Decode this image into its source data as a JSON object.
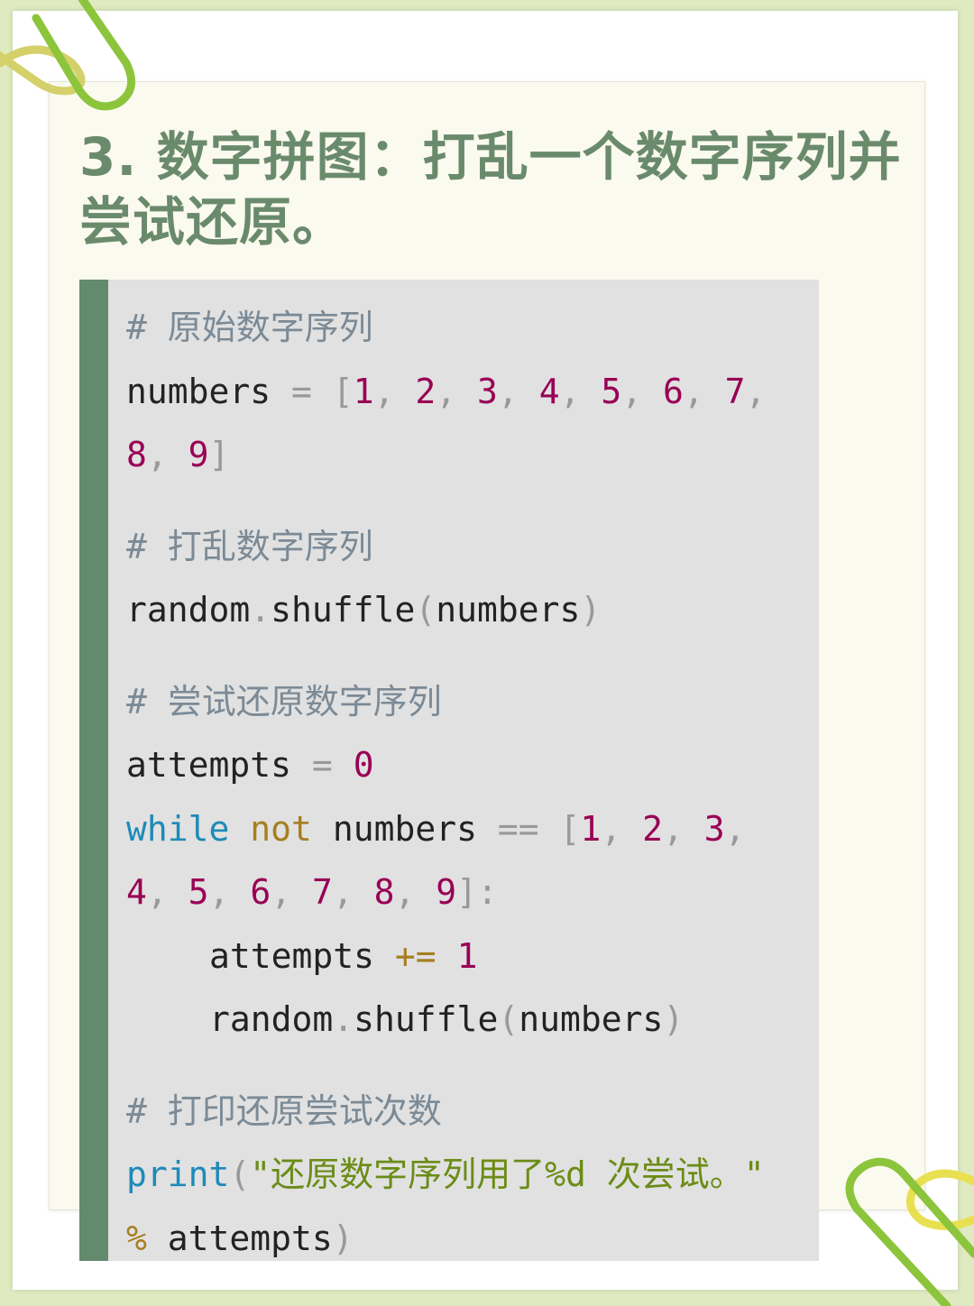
{
  "title": "3. 数字拼图：打乱一个数字序列并尝试还原。",
  "code": {
    "comment1": "# 原始数字序列",
    "comment2": "# 打乱数字序列",
    "comment3": "# 尝试还原数字序列",
    "comment4": "# 打印还原尝试次数",
    "var_numbers": "numbers",
    "var_attempts": "attempts",
    "module_random": "random",
    "func_shuffle": "shuffle",
    "func_print": "print",
    "kw_while": "while",
    "op_not": "not",
    "op_assign": "=",
    "op_eq": "==",
    "op_pluseq": "+=",
    "op_mod": "%",
    "zero": "0",
    "one": "1",
    "digits": [
      "1",
      "2",
      "3",
      "4",
      "5",
      "6",
      "7",
      "8",
      "9"
    ],
    "string_literal": "\"还原数字序列用了%d 次尝试。\""
  },
  "colors": {
    "title": "#6a8a6c",
    "code_background": "#e1e1e1",
    "code_border": "#648a6e",
    "comment": "#7b8a96",
    "number": "#990055",
    "keyword": "#1e8ab8",
    "operator": "#a67f1f",
    "string": "#6b8c16",
    "clip_green": "#8cc43c",
    "clip_yellow": "#e8e050"
  }
}
